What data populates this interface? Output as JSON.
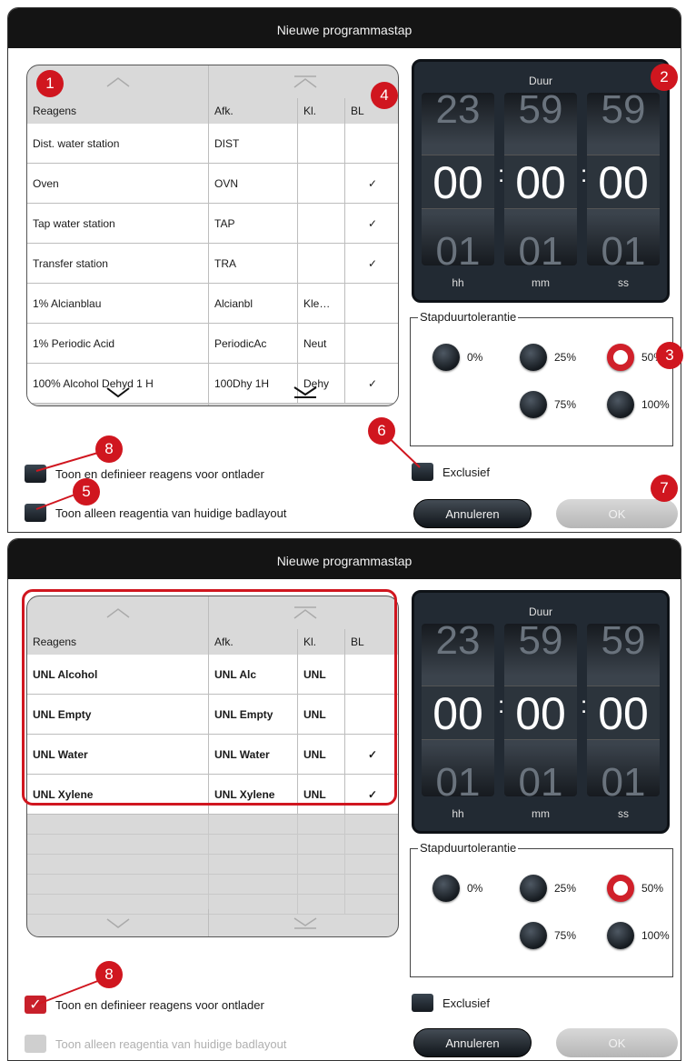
{
  "dialogs": [
    {
      "title": "Nieuwe programmastap",
      "table": {
        "columns": [
          "Reagens",
          "Afk.",
          "Kl.",
          "BL"
        ],
        "rows": [
          [
            "Dist. water station",
            "DIST",
            "",
            ""
          ],
          [
            "Oven",
            "OVN",
            "",
            "✓"
          ],
          [
            "Tap water station",
            "TAP",
            "",
            "✓"
          ],
          [
            "Transfer station",
            "TRA",
            "",
            "✓"
          ],
          [
            "1% Alcianblau",
            "Alcianbl",
            "Kle…",
            ""
          ],
          [
            "1% Periodic Acid",
            "PeriodicAc",
            "Neut",
            ""
          ],
          [
            "100% Alcohol Dehyd 1 H",
            "100Dhy 1H",
            "Dehy",
            "✓"
          ]
        ]
      },
      "duration": {
        "label": "Duur",
        "hh": {
          "prev": "23",
          "cur": "00",
          "next": "01"
        },
        "mm": {
          "prev": "59",
          "cur": "00",
          "next": "01"
        },
        "ss": {
          "prev": "59",
          "cur": "00",
          "next": "01"
        },
        "units": [
          "hh",
          "mm",
          "ss"
        ]
      },
      "tolerance": {
        "title": "Stapduurtolerantie",
        "options": [
          "0%",
          "25%",
          "50%",
          "75%",
          "100%"
        ],
        "selected": "50%"
      },
      "checkboxes": [
        {
          "label": "Toon en definieer reagens voor ontlader",
          "checked": false
        },
        {
          "label": "Toon alleen reagentia van huidige badlayout",
          "checked": false
        }
      ],
      "exclusive": "Exclusief",
      "cancel": "Annuleren",
      "ok": "OK",
      "callouts": [
        "1",
        "2",
        "3",
        "4",
        "5",
        "6",
        "7",
        "8"
      ]
    },
    {
      "title": "Nieuwe programmastap",
      "table": {
        "columns": [
          "Reagens",
          "Afk.",
          "Kl.",
          "BL"
        ],
        "rows": [
          [
            "UNL Alcohol",
            "UNL Alc",
            "UNL",
            ""
          ],
          [
            "UNL Empty",
            "UNL Empty",
            "UNL",
            ""
          ],
          [
            "UNL Water",
            "UNL Water",
            "UNL",
            "✓"
          ],
          [
            "UNL Xylene",
            "UNL Xylene",
            "UNL",
            "✓"
          ]
        ]
      },
      "duration": {
        "label": "Duur",
        "hh": {
          "prev": "23",
          "cur": "00",
          "next": "01"
        },
        "mm": {
          "prev": "59",
          "cur": "00",
          "next": "01"
        },
        "ss": {
          "prev": "59",
          "cur": "00",
          "next": "01"
        },
        "units": [
          "hh",
          "mm",
          "ss"
        ]
      },
      "tolerance": {
        "title": "Stapduurtolerantie",
        "options": [
          "0%",
          "25%",
          "50%",
          "75%",
          "100%"
        ],
        "selected": "50%"
      },
      "checkboxes": [
        {
          "label": "Toon en definieer reagens voor ontlader",
          "checked": true
        },
        {
          "label": "Toon alleen reagentia van huidige badlayout",
          "checked": false,
          "disabled": true
        }
      ],
      "exclusive": "Exclusief",
      "cancel": "Annuleren",
      "ok": "OK",
      "callouts": [
        "8"
      ]
    }
  ],
  "colors": {
    "accent": "#d0161f",
    "titlebar": "#141414",
    "clock": "#222a33"
  }
}
